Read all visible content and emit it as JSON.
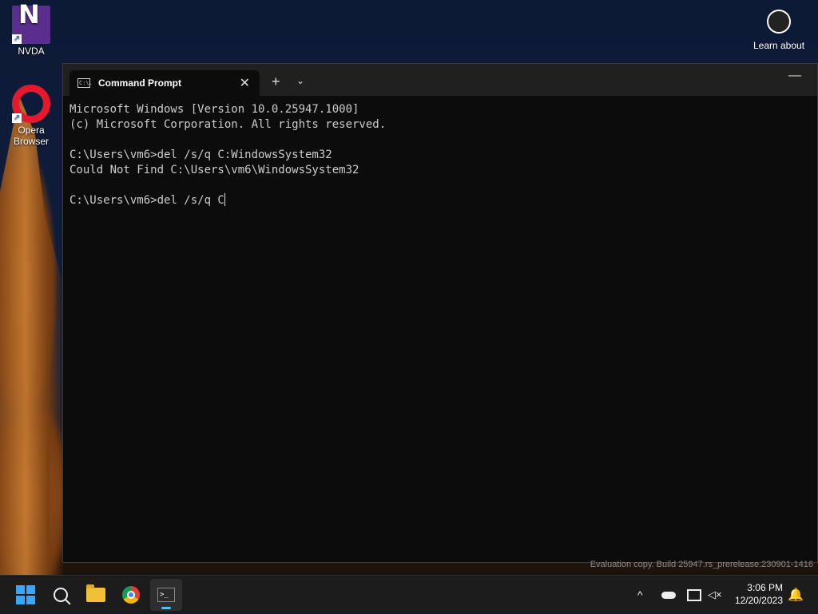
{
  "desktop": {
    "icons": [
      {
        "label": "NVDA",
        "glyph": "N"
      },
      {
        "label": "Opera Browser"
      }
    ],
    "learn_about": "Learn about"
  },
  "window": {
    "tab_title": "Command Prompt",
    "tab_icon_text": "C:\\.",
    "new_tab": "+",
    "dropdown": "⌄",
    "minimize": "—",
    "close_tab": "✕"
  },
  "console": {
    "lines": [
      "Microsoft Windows [Version 10.0.25947.1000]",
      "(c) Microsoft Corporation. All rights reserved.",
      "",
      "C:\\Users\\vm6>del /s/q C:WindowsSystem32",
      "Could Not Find C:\\Users\\vm6\\WindowsSystem32",
      "",
      "C:\\Users\\vm6>del /s/q C"
    ]
  },
  "watermark": "Evaluation copy. Build 25947.rs_prerelease.230901-1416",
  "taskbar": {
    "time": "3:06 PM",
    "date": "12/20/2023",
    "tray_chevron": "^",
    "accent": "#4cc2ff"
  }
}
